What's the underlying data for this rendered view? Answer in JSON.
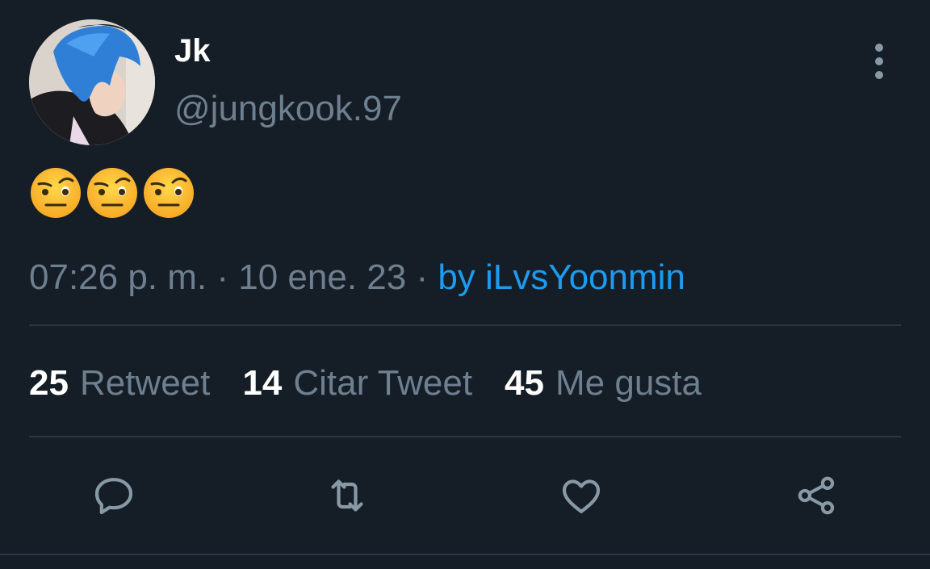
{
  "tweet": {
    "author_name": "Jk",
    "author_handle": "@jungkook.97",
    "emoji_text": "🤨🤨🤨",
    "time": "07:26 p. m.",
    "sep1": " · ",
    "date": "10 ene. 23",
    "sep2": " · ",
    "source": "by iLvsYoonmin"
  },
  "stats": {
    "retweets_count": "25",
    "retweets_label": "Retweet",
    "quotes_count": "14",
    "quotes_label": "Citar Tweet",
    "likes_count": "45",
    "likes_label": "Me gusta"
  },
  "actions": {
    "reply_icon": "reply-icon",
    "retweet_icon": "retweet-icon",
    "like_icon": "heart-icon",
    "share_icon": "share-icon"
  },
  "colors": {
    "background": "#151d27",
    "secondary_text": "#6e7f8f",
    "link": "#1d9bf0",
    "divider": "#2c3641"
  }
}
